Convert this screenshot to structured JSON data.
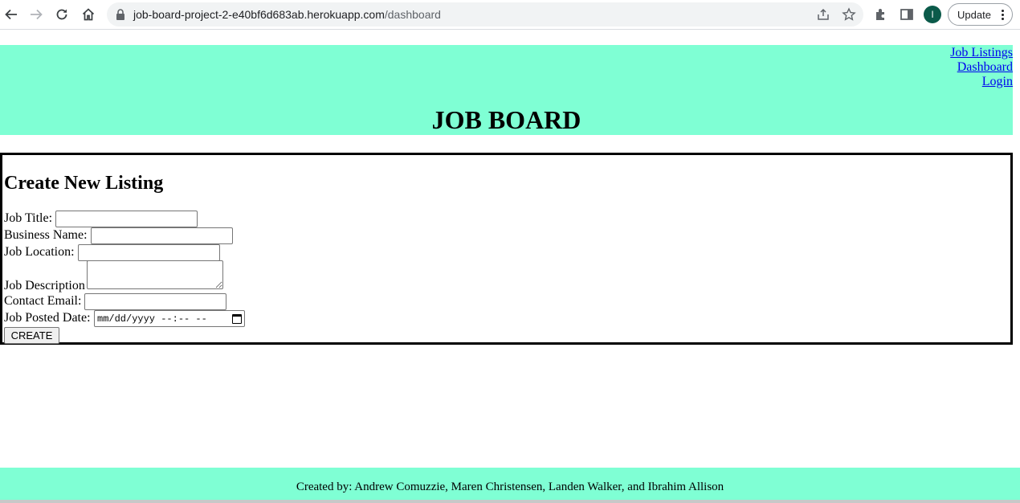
{
  "browser": {
    "url_host": "job-board-project-2-e40bf6d683ab.herokuapp.com",
    "url_path": "/dashboard",
    "profile_initial": "I",
    "update_label": "Update"
  },
  "header": {
    "nav": [
      "Job Listings",
      "Dashboard",
      "Login"
    ],
    "title": "JOB BOARD",
    "background": "#7fffd4"
  },
  "form": {
    "title": "Create New Listing",
    "fields": {
      "job_title": "Job Title:",
      "business_name": "Business Name:",
      "job_location": "Job Location:",
      "job_description": "Job Description",
      "contact_email": "Contact Email:",
      "job_posted_date": "Job Posted Date:"
    },
    "date_placeholder": "mm/dd/yyyy --:-- --",
    "submit_label": "CREATE"
  },
  "footer": {
    "text": "Created by: Andrew Comuzzie, Maren Christensen, Landen Walker, and Ibrahim Allison"
  }
}
